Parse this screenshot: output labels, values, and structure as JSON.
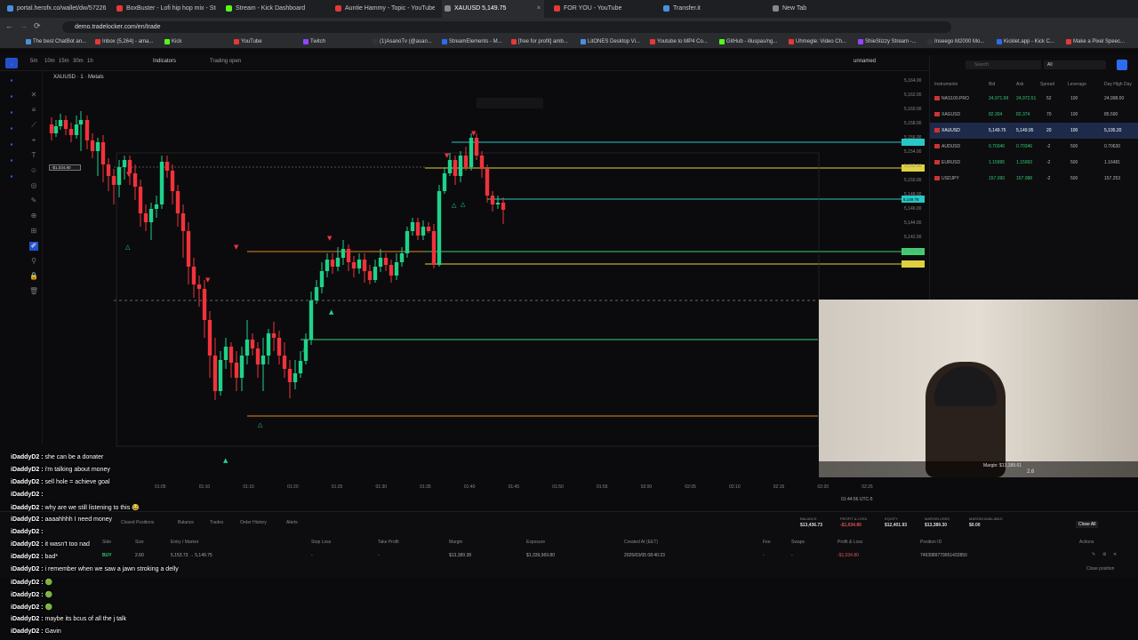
{
  "browser": {
    "tabs": [
      {
        "label": "portal.herofx.co/wallet/dw/5722612",
        "color": "#4a90e2"
      },
      {
        "label": "BoxBuster - Lofi hip hop mix - Stre",
        "color": "#e53935"
      },
      {
        "label": "Stream - Kick Dashboard",
        "color": "#53fc18"
      },
      {
        "label": "Auntie Hammy - Topic - YouTube",
        "color": "#e53935"
      },
      {
        "label": "XAUUSD 5,149.75",
        "color": "#888888"
      },
      {
        "label": "FOR YOU - YouTube",
        "color": "#e53935"
      },
      {
        "label": "Transfer.it",
        "color": "#4a90e2"
      },
      {
        "label": "New Tab",
        "color": "#888888"
      }
    ],
    "active_tab_index": 4,
    "url": "demo.tradelocker.com/en/trade",
    "bookmarks": [
      "The best ChatBot an...",
      "Inbox (5,264) - ama...",
      "Kick",
      "YouTube",
      "Twitch",
      "(1)AsanoTv (@asan...",
      "StreamElements - M...",
      "[free for profit] amb...",
      "LitONES Desktop Vi...",
      "Youtube to MP4 Co...",
      "GitHub - illuspas/ng...",
      "Uhmegle: Video Ch...",
      "ShieStizzy Stream -...",
      "Inseego M2000 Mo...",
      "Kicklet.app - Kick C...",
      "Make a Pixel Speec..."
    ]
  },
  "chart": {
    "timeframes": [
      "5m",
      "10m",
      "15m",
      "30m",
      "1h"
    ],
    "indicators_label": "Indicators",
    "trading_status": "Trading open",
    "layout_name": "unnamed",
    "symbol_line": "XAUUSD · 1 · Metals",
    "price_labels": [
      "5,164.00",
      "5,162.00",
      "5,160.00",
      "5,158.00",
      "5,156.00",
      "5,154.00",
      "5,152.00",
      "5,150.00",
      "5,148.00",
      "5,146.00",
      "5,144.00",
      "5,142.00",
      "5,140.00"
    ],
    "time_labels": [
      "01:05",
      "01:10",
      "01:15",
      "01:20",
      "01:25",
      "01:30",
      "01:35",
      "01:40",
      "01:45",
      "01:50",
      "01:55",
      "02:00",
      "02:05",
      "02:10",
      "02:15",
      "02:20",
      "02:25"
    ],
    "position_tag": "-$1,034.80",
    "clock": "01:44:56 UTC-5",
    "current_price_tag": "5,149.75"
  },
  "instruments": {
    "search_placeholder": "Search",
    "filter": "All",
    "headers": [
      "Instruments",
      "Bid",
      "Ask",
      "Spread",
      "Leverage",
      "Day High",
      "Day"
    ],
    "rows": [
      {
        "name": "NAS100.PRO",
        "bid": "24,971.99",
        "ask": "24,972.51",
        "spread": "52",
        "lev": "100",
        "high": "24,998.00"
      },
      {
        "name": "XAGUSD",
        "bid": "82.304",
        "ask": "82.374",
        "spread": "70",
        "lev": "100",
        "high": "85.590"
      },
      {
        "name": "XAUUSD",
        "bid": "5,149.75",
        "ask": "5,149.95",
        "spread": "20",
        "lev": "100",
        "high": "5,195.20"
      },
      {
        "name": "AUDUSD",
        "bid": "0.70346",
        "ask": "0.70346",
        "spread": "-2",
        "lev": "500",
        "high": "0.70630"
      },
      {
        "name": "EURUSD",
        "bid": "1.15995",
        "ask": "1.15993",
        "spread": "-2",
        "lev": "500",
        "high": "1.16481"
      },
      {
        "name": "USDJPY",
        "bid": "157.090",
        "ask": "157.088",
        "spread": "-2",
        "lev": "500",
        "high": "157.253"
      }
    ],
    "selected_index": 2
  },
  "bottom": {
    "tabs": [
      "Closed Positions",
      "Balance",
      "Trades",
      "Order History",
      "Alerts"
    ],
    "summary": [
      {
        "label": "BALANCE",
        "value": "$13,436.73",
        "color": "#dddddd"
      },
      {
        "label": "PROFIT & LOSS",
        "value": "-$1,034.80",
        "color": "#e05252"
      },
      {
        "label": "EQUITY",
        "value": "$12,401.93",
        "color": "#dddddd"
      },
      {
        "label": "MARGIN USED",
        "value": "$13,389.30",
        "color": "#dddddd"
      },
      {
        "label": "MARGIN AVAILABLE",
        "value": "$0.00",
        "color": "#dddddd"
      }
    ],
    "close_all": "Close All",
    "columns": [
      "Side",
      "Size",
      "Entry / Market",
      "Stop Loss",
      "Take Profit",
      "Margin",
      "Exposure",
      "Created At (EET)",
      "Fee",
      "Swaps",
      "Profit & Loss",
      "Position ID",
      "Actions"
    ],
    "position": {
      "side": "BUY",
      "size": "2.60",
      "entry": "5,153.73 → 5,149.75",
      "sl": "-",
      "tp": "-",
      "margin": "$13,389.38",
      "exposure": "$1,339,969.80",
      "created": "2026/03/05 08:40:23",
      "fee": "-",
      "swaps": "-",
      "pnl": "-$1,034.80",
      "id": "7493989779951432850"
    },
    "close_position": "Close position",
    "trade_margin": "Margin: $13,389.61",
    "trade_qty": "2.6"
  },
  "chat": [
    {
      "user": "iDaddyD2",
      "msg": "she can be a donater"
    },
    {
      "user": "iDaddyD2",
      "msg": "i'm talking about money"
    },
    {
      "user": "iDaddyD2",
      "msg": "sell hole = achieve goal"
    },
    {
      "user": "iDaddyD2",
      "msg": ""
    },
    {
      "user": "iDaddyD2",
      "msg": "why are we still listening to this 😂"
    },
    {
      "user": "iDaddyD2",
      "msg": "aaaahhhh I need money"
    },
    {
      "user": "iDaddyD2",
      "msg": ""
    },
    {
      "user": "iDaddyD2",
      "msg": "it wasn't too nad"
    },
    {
      "user": "iDaddyD2",
      "msg": "bad*"
    },
    {
      "user": "iDaddyD2",
      "msg": "i remember when we saw a jawn stroking a delly"
    },
    {
      "user": "iDaddyD2",
      "msg": "🟢"
    },
    {
      "user": "iDaddyD2",
      "msg": "🟢"
    },
    {
      "user": "iDaddyD2",
      "msg": "🟢"
    },
    {
      "user": "iDaddyD2",
      "msg": "maybe its bcus of all the j talk"
    },
    {
      "user": "iDaddyD2",
      "msg": "Gavin"
    }
  ]
}
